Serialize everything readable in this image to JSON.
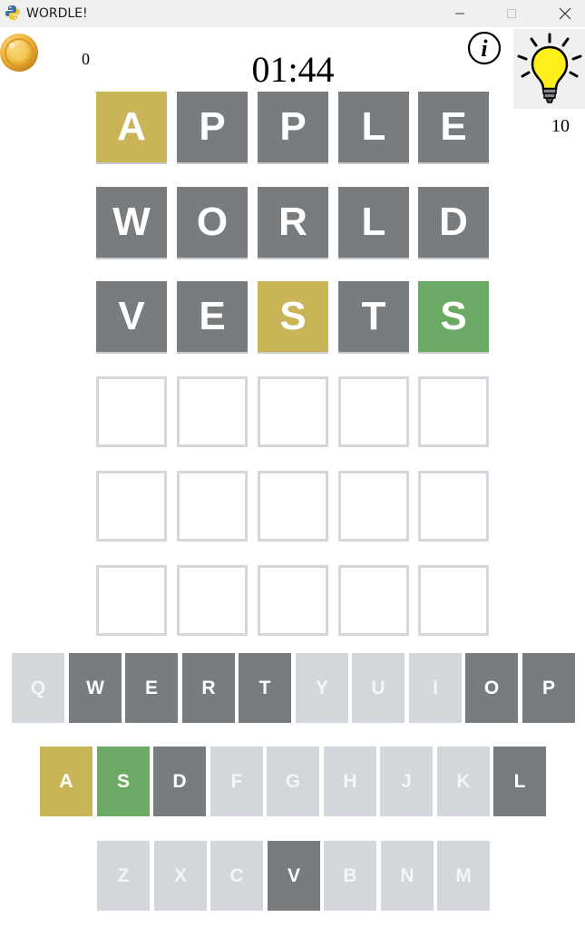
{
  "window": {
    "title": "WORDLE!",
    "controls": [
      "minimize",
      "maximize",
      "close"
    ]
  },
  "header": {
    "coins": "0",
    "timer": "01:44",
    "hints": "10",
    "icons": [
      "coin-icon",
      "info-icon",
      "lightbulb-icon"
    ]
  },
  "board": {
    "rows": [
      [
        {
          "letter": "A",
          "state": "present"
        },
        {
          "letter": "P",
          "state": "absent"
        },
        {
          "letter": "P",
          "state": "absent"
        },
        {
          "letter": "L",
          "state": "absent"
        },
        {
          "letter": "E",
          "state": "absent"
        }
      ],
      [
        {
          "letter": "W",
          "state": "absent"
        },
        {
          "letter": "O",
          "state": "absent"
        },
        {
          "letter": "R",
          "state": "absent"
        },
        {
          "letter": "L",
          "state": "absent"
        },
        {
          "letter": "D",
          "state": "absent"
        }
      ],
      [
        {
          "letter": "V",
          "state": "absent"
        },
        {
          "letter": "E",
          "state": "absent"
        },
        {
          "letter": "S",
          "state": "present"
        },
        {
          "letter": "T",
          "state": "absent"
        },
        {
          "letter": "S",
          "state": "correct"
        }
      ],
      [
        {
          "letter": "",
          "state": "empty"
        },
        {
          "letter": "",
          "state": "empty"
        },
        {
          "letter": "",
          "state": "empty"
        },
        {
          "letter": "",
          "state": "empty"
        },
        {
          "letter": "",
          "state": "empty"
        }
      ],
      [
        {
          "letter": "",
          "state": "empty"
        },
        {
          "letter": "",
          "state": "empty"
        },
        {
          "letter": "",
          "state": "empty"
        },
        {
          "letter": "",
          "state": "empty"
        },
        {
          "letter": "",
          "state": "empty"
        }
      ],
      [
        {
          "letter": "",
          "state": "empty"
        },
        {
          "letter": "",
          "state": "empty"
        },
        {
          "letter": "",
          "state": "empty"
        },
        {
          "letter": "",
          "state": "empty"
        },
        {
          "letter": "",
          "state": "empty"
        }
      ]
    ]
  },
  "keyboard": {
    "rows": [
      [
        {
          "key": "Q",
          "state": "unused"
        },
        {
          "key": "W",
          "state": "absent"
        },
        {
          "key": "E",
          "state": "absent"
        },
        {
          "key": "R",
          "state": "absent"
        },
        {
          "key": "T",
          "state": "absent"
        },
        {
          "key": "Y",
          "state": "unused"
        },
        {
          "key": "U",
          "state": "unused"
        },
        {
          "key": "I",
          "state": "unused"
        },
        {
          "key": "O",
          "state": "absent"
        },
        {
          "key": "P",
          "state": "absent"
        }
      ],
      [
        {
          "key": "A",
          "state": "present"
        },
        {
          "key": "S",
          "state": "correct"
        },
        {
          "key": "D",
          "state": "absent"
        },
        {
          "key": "F",
          "state": "unused"
        },
        {
          "key": "G",
          "state": "unused"
        },
        {
          "key": "H",
          "state": "unused"
        },
        {
          "key": "J",
          "state": "unused"
        },
        {
          "key": "K",
          "state": "unused"
        },
        {
          "key": "L",
          "state": "absent"
        }
      ],
      [
        {
          "key": "Z",
          "state": "unused"
        },
        {
          "key": "X",
          "state": "unused"
        },
        {
          "key": "C",
          "state": "unused"
        },
        {
          "key": "V",
          "state": "absent"
        },
        {
          "key": "B",
          "state": "unused"
        },
        {
          "key": "N",
          "state": "unused"
        },
        {
          "key": "M",
          "state": "unused"
        }
      ]
    ]
  },
  "colors": {
    "correct": "#6aaa64",
    "present": "#c9b458",
    "absent": "#787c7e",
    "unused": "#d3d6da"
  }
}
